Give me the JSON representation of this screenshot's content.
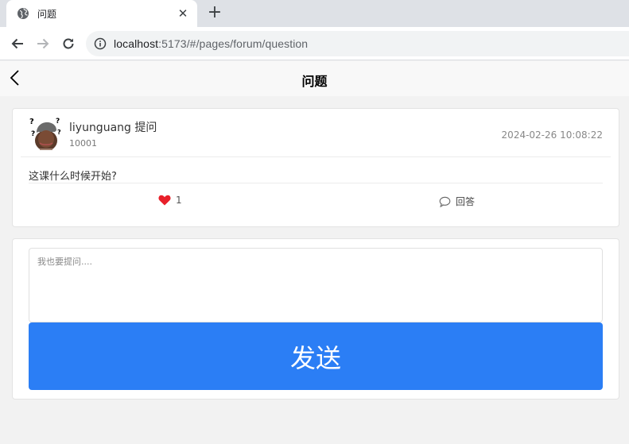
{
  "browser": {
    "tab_title": "问题",
    "tab_close": "✕",
    "new_tab": "+",
    "url_host": "localhost",
    "url_rest": ":5173/#/pages/forum/question"
  },
  "app": {
    "title": "问题"
  },
  "question": {
    "user_line": "liyunguang 提问",
    "user_id": "10001",
    "time": "2024-02-26 10:08:22",
    "content": "这课什么时候开始?",
    "like_count": "1",
    "answer_label": "回答"
  },
  "ask": {
    "placeholder": "我也要提问....",
    "send_label": "发送"
  },
  "colors": {
    "primary": "#2b7ef5",
    "like": "#e8202a"
  }
}
